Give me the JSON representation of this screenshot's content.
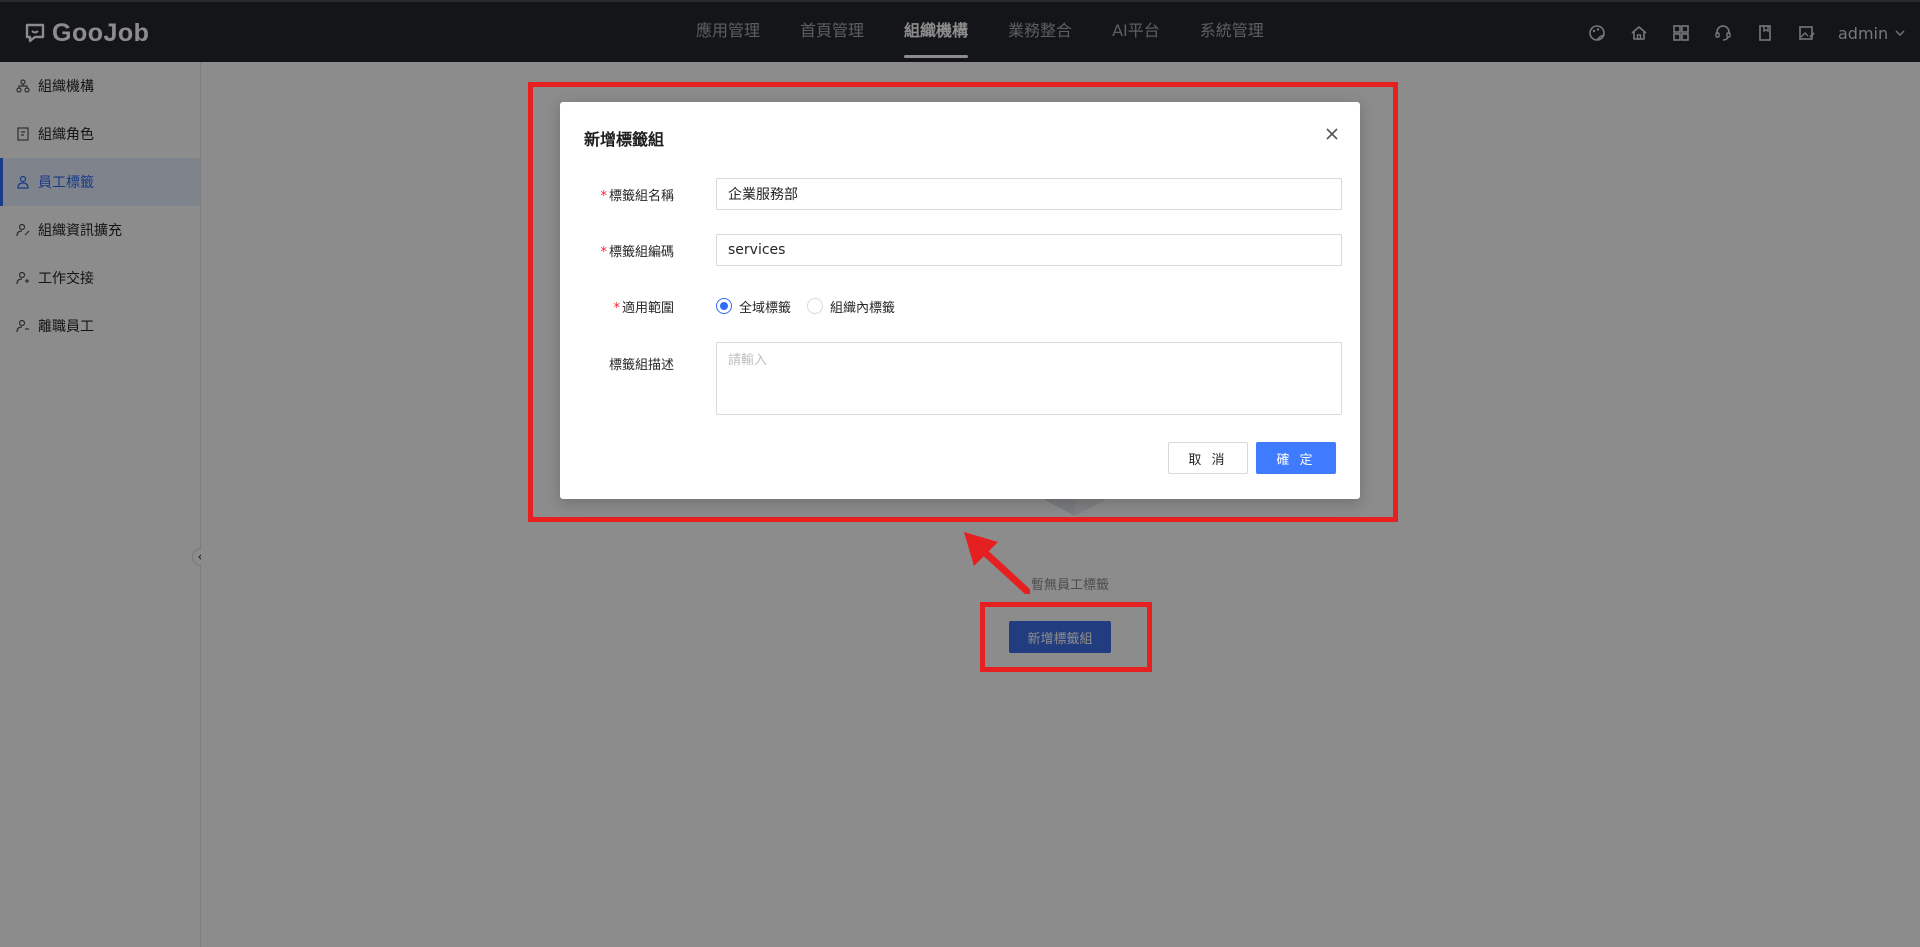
{
  "app": {
    "logo_text": "GooJob"
  },
  "nav": {
    "items": [
      {
        "label": "應用管理",
        "active": false
      },
      {
        "label": "首頁管理",
        "active": false
      },
      {
        "label": "組織機構",
        "active": true
      },
      {
        "label": "業務整合",
        "active": false
      },
      {
        "label": "AI平台",
        "active": false
      },
      {
        "label": "系統管理",
        "active": false
      }
    ]
  },
  "header": {
    "icons": [
      "palette-icon",
      "home-icon",
      "grid-icon",
      "support-icon",
      "book-icon",
      "image-edit-icon"
    ],
    "user": "admin"
  },
  "sidebar": {
    "items": [
      {
        "label": "組織機構",
        "icon": "org-icon",
        "active": false
      },
      {
        "label": "組織角色",
        "icon": "role-icon",
        "active": false
      },
      {
        "label": "員工標籤",
        "icon": "user-tag-icon",
        "active": true
      },
      {
        "label": "組織資訊擴充",
        "icon": "user-edit-icon",
        "active": false
      },
      {
        "label": "工作交接",
        "icon": "user-transfer-icon",
        "active": false
      },
      {
        "label": "離職員工",
        "icon": "user-leave-icon",
        "active": false
      }
    ]
  },
  "main": {
    "empty_text": "暫無員工標籤",
    "add_group_label": "新增標籤組"
  },
  "modal": {
    "title": "新增標籤組",
    "fields": {
      "name": {
        "label": "標籤組名稱",
        "required": true,
        "value": "企業服務部"
      },
      "code": {
        "label": "標籤組編碼",
        "required": true,
        "value": "services"
      },
      "scope": {
        "label": "適用範圍",
        "required": true,
        "options": [
          {
            "label": "全域標籤",
            "checked": true
          },
          {
            "label": "組織內標籤",
            "checked": false
          }
        ]
      },
      "description": {
        "label": "標籤組描述",
        "required": false,
        "placeholder": "請輸入"
      }
    },
    "cancel_label": "取 消",
    "ok_label": "確 定"
  },
  "colors": {
    "primary": "#3f7bff",
    "topbar": "#24272d",
    "annotation": "#e62020"
  }
}
